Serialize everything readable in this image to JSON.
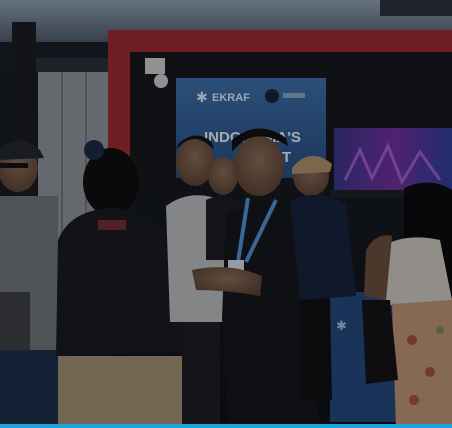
{
  "banner": {
    "logo_text": "EKRAF",
    "headline_line1": "INDONESIA'S",
    "headline_line2": "ST"
  },
  "bottom_bar_color": "#1fa4e0"
}
